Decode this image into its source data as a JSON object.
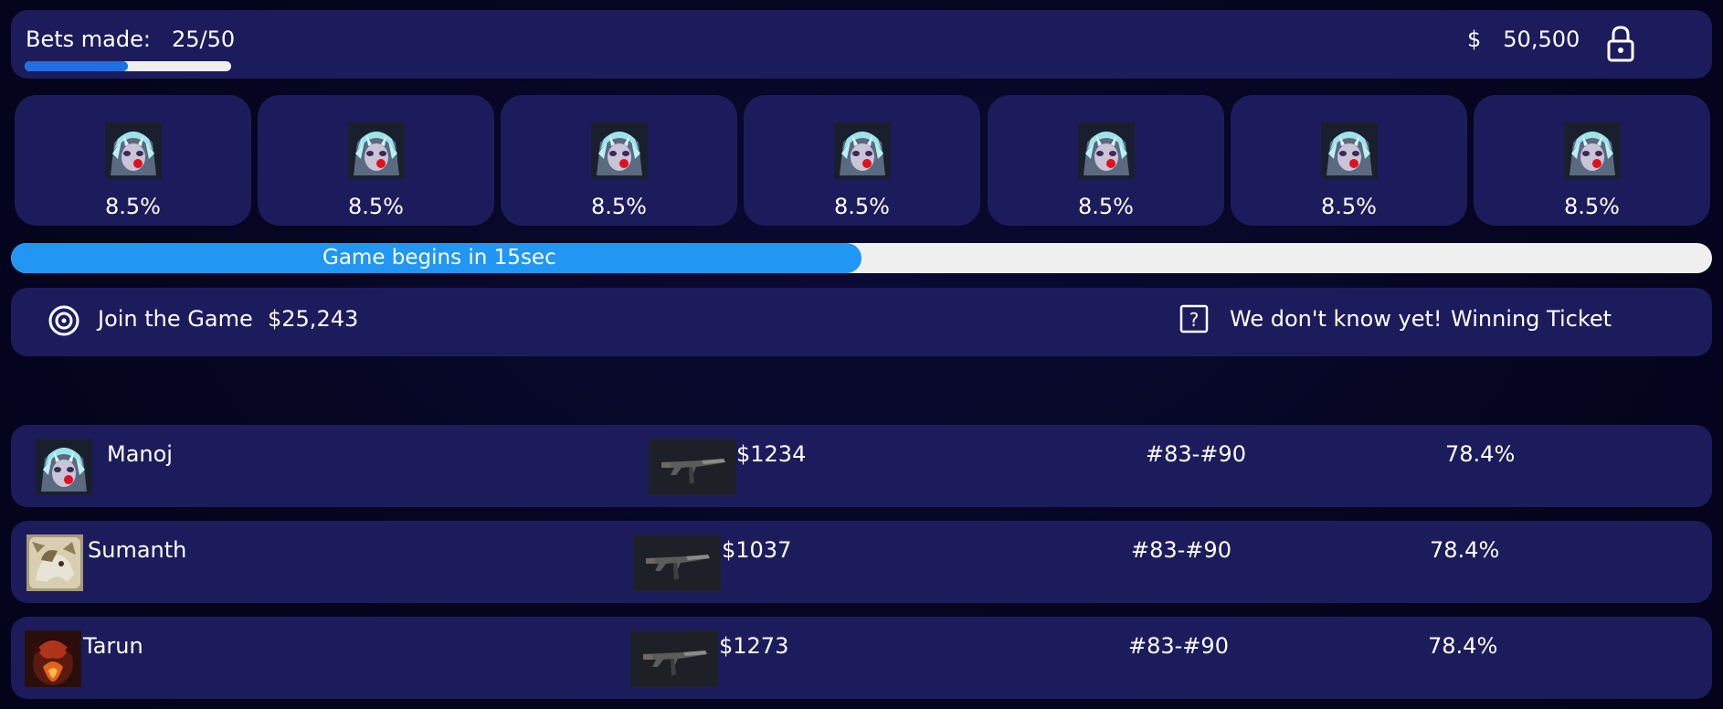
{
  "header": {
    "bets_label": "Bets made:",
    "bets_value": "25/50",
    "bets_progress": 0.5,
    "currency": "$",
    "balance": "50,500",
    "lock_icon": "lock-icon"
  },
  "cards": [
    {
      "percent": "8.5%",
      "icon": "character-avatar"
    },
    {
      "percent": "8.5%",
      "icon": "character-avatar"
    },
    {
      "percent": "8.5%",
      "icon": "character-avatar"
    },
    {
      "percent": "8.5%",
      "icon": "character-avatar"
    },
    {
      "percent": "8.5%",
      "icon": "character-avatar"
    },
    {
      "percent": "8.5%",
      "icon": "character-avatar"
    },
    {
      "percent": "8.5%",
      "icon": "character-avatar"
    }
  ],
  "countdown": {
    "label": "Game begins in 15sec",
    "progress": 0.5
  },
  "join": {
    "label": "Join the Game",
    "amount": "$25,243",
    "status": "We don't know yet!",
    "winning_label": "Winning Ticket",
    "target_icon": "target-icon",
    "question_icon": "question-box-icon"
  },
  "players": [
    {
      "name": "Manoj",
      "amount": "$1234",
      "tickets": "#83-#90",
      "chance": "78.4%",
      "avatar": "character-avatar",
      "item": "rifle-skin"
    },
    {
      "name": "Sumanth",
      "amount": "$1037",
      "tickets": "#83-#90",
      "chance": "78.4%",
      "avatar": "beast-avatar",
      "item": "rifle-skin"
    },
    {
      "name": "Tarun",
      "amount": "$1273",
      "tickets": "#83-#90",
      "chance": "78.4%",
      "avatar": "fire-demon-avatar",
      "item": "rifle-skin"
    }
  ],
  "colors": {
    "background": "#05051f",
    "panel": "#1c1c5c",
    "accent_blue": "#2196f3",
    "progress_blue": "#1f6fe6",
    "track": "#efefef"
  }
}
